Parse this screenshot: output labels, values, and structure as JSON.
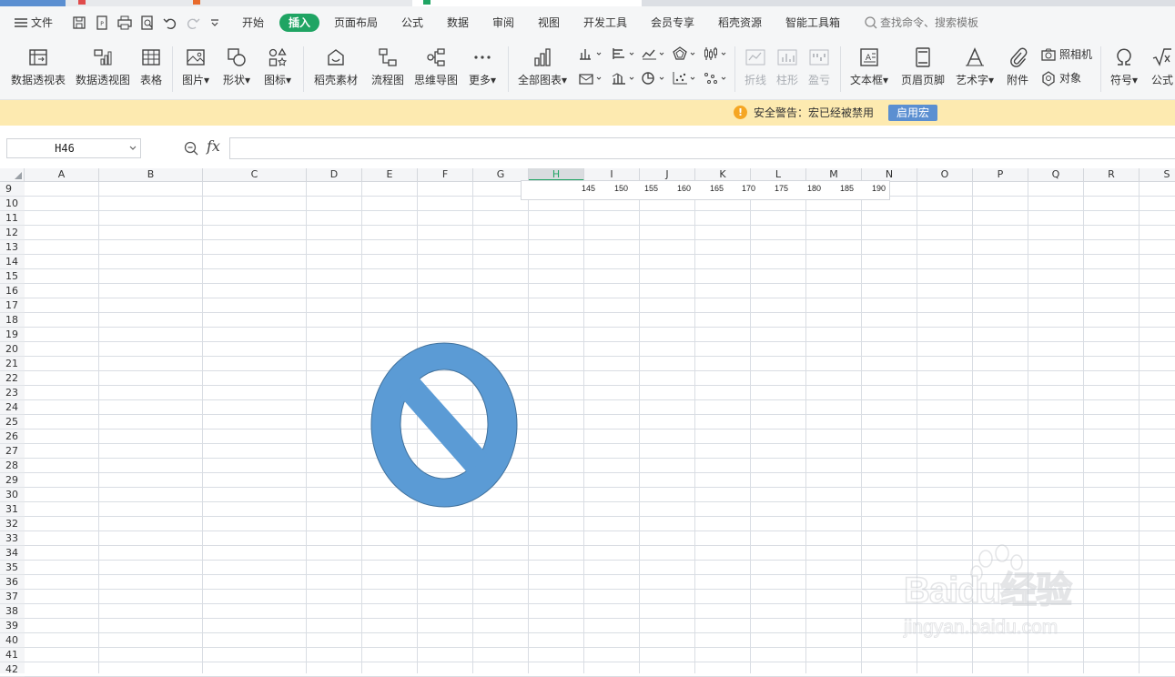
{
  "menubar": {
    "file": "文件",
    "tabs": [
      "开始",
      "插入",
      "页面布局",
      "公式",
      "数据",
      "审阅",
      "视图",
      "开发工具",
      "会员专享",
      "稻壳资源",
      "智能工具箱"
    ],
    "active_tab": "插入",
    "search_placeholder": "查找命令、搜索模板"
  },
  "ribbon": {
    "pivot_table": "数据透视表",
    "pivot_chart": "数据透视图",
    "table": "表格",
    "picture": "图片",
    "shape": "形状",
    "icon": "图标",
    "docer_material": "稻壳素材",
    "flowchart": "流程图",
    "mindmap": "思维导图",
    "more": "更多",
    "all_charts": "全部图表",
    "spark_line": "折线",
    "spark_column": "柱形",
    "spark_winloss": "盈亏",
    "textbox": "文本框",
    "header_footer": "页眉页脚",
    "wordart": "艺术字",
    "attachment": "附件",
    "camera": "照相机",
    "object": "对象",
    "symbol": "符号",
    "formula": "公式"
  },
  "warning": {
    "text": "安全警告：宏已经被禁用",
    "button": "启用宏"
  },
  "formula_bar": {
    "cell_ref": "H46",
    "fx": "fx",
    "value": ""
  },
  "grid": {
    "columns": [
      "A",
      "B",
      "C",
      "D",
      "E",
      "F",
      "G",
      "H",
      "I",
      "J",
      "K",
      "L",
      "M",
      "N",
      "O",
      "P",
      "Q",
      "R",
      "S"
    ],
    "selected_column": "H",
    "rows": [
      "9",
      "10",
      "11",
      "12",
      "13",
      "14",
      "15",
      "16",
      "17",
      "18",
      "19",
      "20",
      "21",
      "22",
      "23",
      "24",
      "25",
      "26",
      "27",
      "28",
      "29",
      "30",
      "31",
      "32",
      "33",
      "34",
      "35",
      "36",
      "37",
      "38",
      "39",
      "40",
      "41",
      "42"
    ],
    "floating_values": [
      "145",
      "150",
      "155",
      "160",
      "165",
      "170",
      "175",
      "180",
      "185",
      "190"
    ]
  },
  "shape": {
    "name": "prohibit-symbol",
    "fill": "#5b9bd5",
    "stroke": "#41719c"
  },
  "watermark": {
    "logo": "Baidu经验",
    "url": "jingyan.baidu.com"
  },
  "colors": {
    "accent": "#1fa463",
    "warning_bg": "#fdeab0",
    "macro_button": "#5b8fd1"
  }
}
